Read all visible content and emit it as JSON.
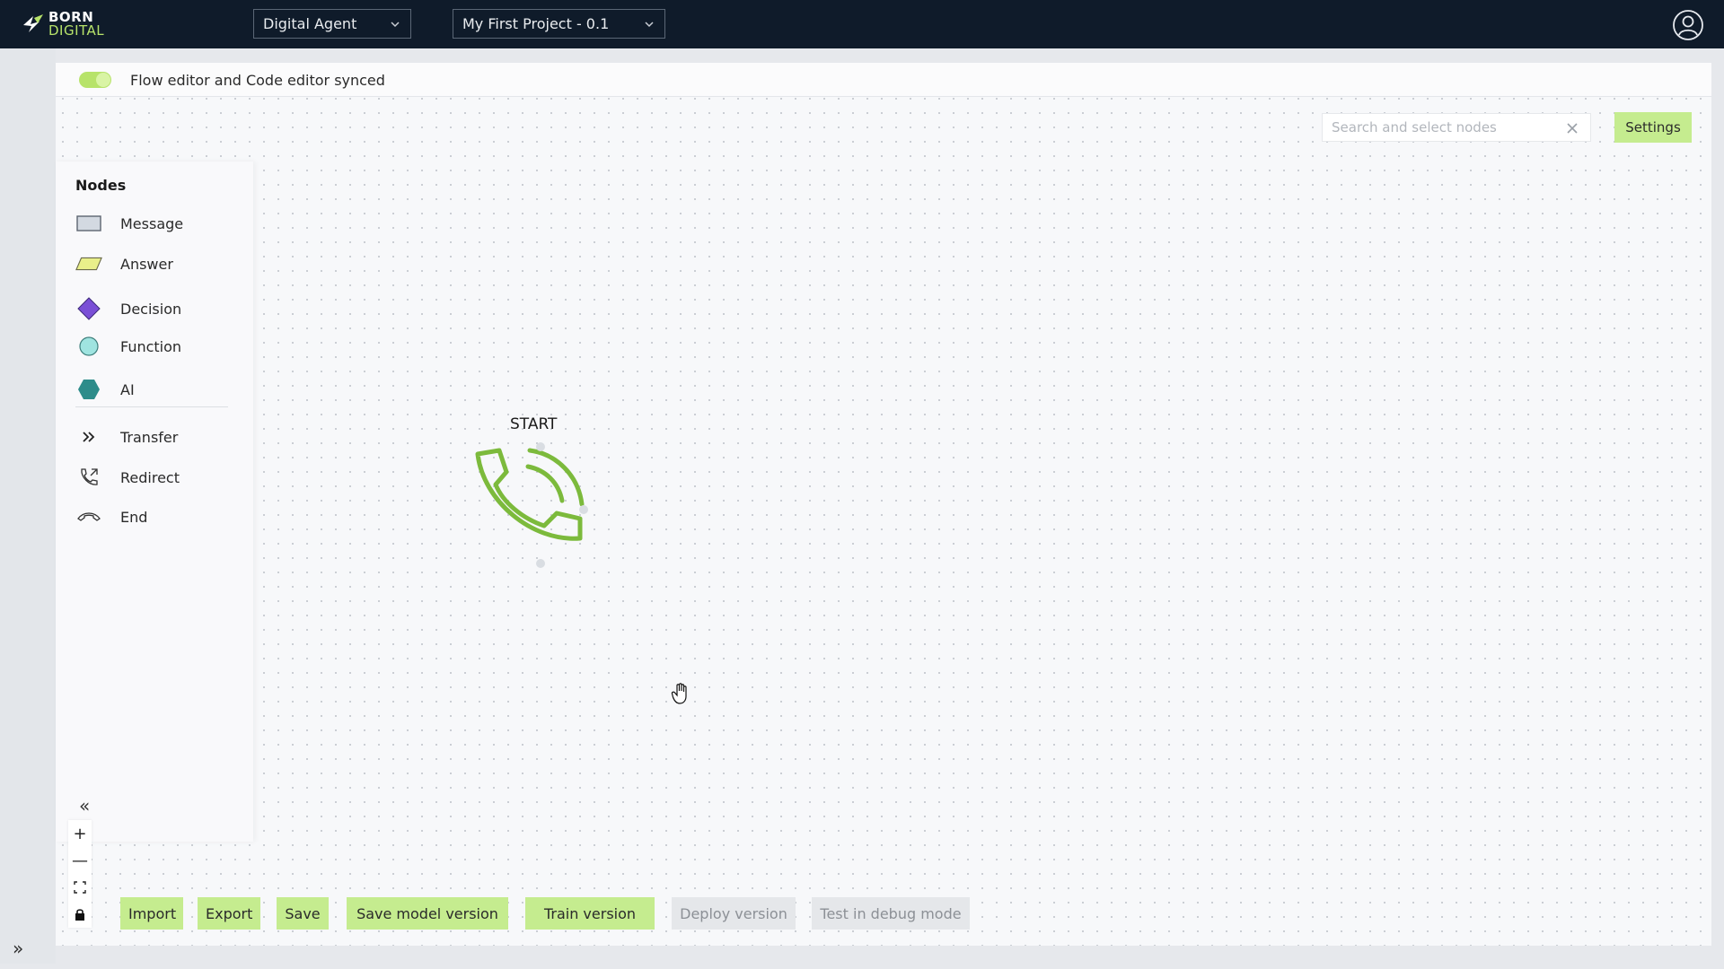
{
  "header": {
    "logo_line1": "BORN",
    "logo_line2": "DIGITAL",
    "agent_select": "Digital Agent",
    "project_select": "My First Project - 0.1"
  },
  "sync": {
    "label": "Flow editor and Code editor synced",
    "enabled": true
  },
  "search": {
    "placeholder": "Search and select nodes",
    "value": ""
  },
  "settings_label": "Settings",
  "nodes_panel": {
    "title": "Nodes",
    "items": [
      {
        "label": "Message",
        "icon": "message-rect-icon"
      },
      {
        "label": "Answer",
        "icon": "answer-parallelogram-icon"
      },
      {
        "label": "Decision",
        "icon": "decision-diamond-icon"
      },
      {
        "label": "Function",
        "icon": "function-circle-icon"
      },
      {
        "label": "AI",
        "icon": "ai-hexagon-icon"
      },
      {
        "label": "Transfer",
        "icon": "transfer-chevrons-icon"
      },
      {
        "label": "Redirect",
        "icon": "redirect-phone-icon"
      },
      {
        "label": "End",
        "icon": "end-call-icon"
      }
    ]
  },
  "canvas": {
    "start_label": "START"
  },
  "zoom": {
    "plus": "+",
    "minus": "—"
  },
  "toolbar": {
    "import": "Import",
    "export": "Export",
    "save": "Save",
    "save_model_version": "Save model version",
    "train_version": "Train version",
    "deploy_version": "Deploy version",
    "test_debug": "Test in debug mode"
  },
  "colors": {
    "topbar": "#0f1b2a",
    "accent_green": "#c5ec8f",
    "phone_green": "#7cba3c",
    "decision_purple": "#7a4fd6",
    "function_teal": "#9fe4e0",
    "ai_teal": "#2d8c8a",
    "answer_yellow": "#e9ef8a"
  }
}
